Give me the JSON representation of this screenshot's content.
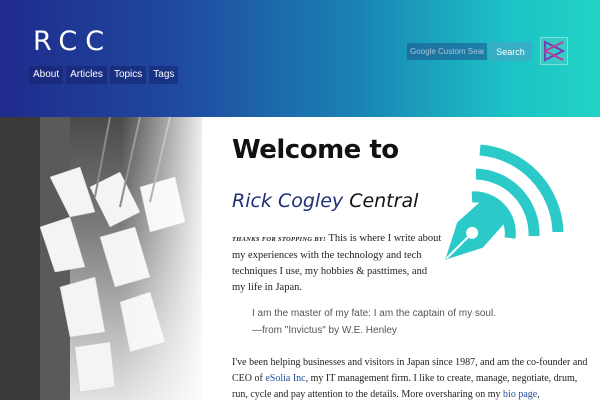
{
  "site": {
    "logo": "RCC",
    "nav": [
      "About",
      "Articles",
      "Topics",
      "Tags"
    ],
    "search": {
      "placeholder": "Google Custom Search",
      "button": "Search"
    }
  },
  "main": {
    "title": "Welcome to",
    "subtitle_name": "Rick Cogley",
    "subtitle_rest": "Central",
    "intro_lead": "Thanks for stopping by!",
    "intro_body": "This is where I write about my experiences with the technology and tech techniques I use, my hobbies & pasttimes, and my life in Japan.",
    "quote_line1": "I am the master of my fate: I am the captain of my soul.",
    "quote_line2": "—from \"Invictus\" by W.E. Henley",
    "bio_part1": "I've been helping businesses and visitors in Japan since 1987, and am the co-founder and CEO of",
    "bio_link1": "eSolia Inc",
    "bio_part2": ", my IT management firm. I like to create, manage, negotiate, drum, run, cycle and pay attention to the details. More oversharing on my",
    "bio_link2": "bio page",
    "bio_part3": ","
  },
  "colors": {
    "header_start": "#1f2b8c",
    "header_end": "#22d3c4",
    "accent_teal": "#2cc9c9",
    "link": "#1f4a98"
  }
}
